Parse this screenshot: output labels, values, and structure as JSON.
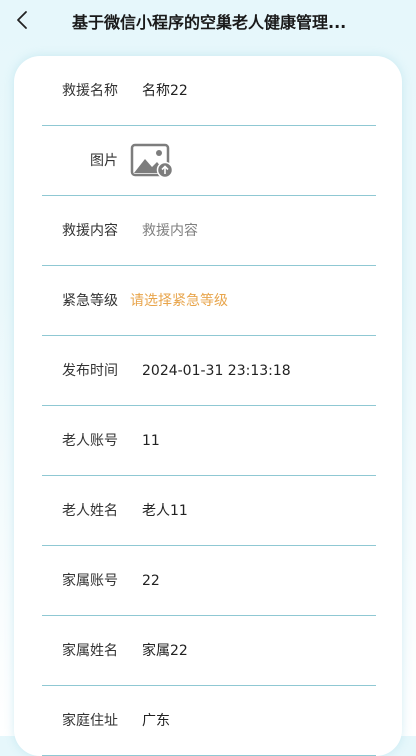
{
  "header": {
    "title": "基于微信小程序的空巢老人健康管理..."
  },
  "form": {
    "rows": [
      {
        "label": "救援名称",
        "value": "名称22",
        "kind": "text"
      },
      {
        "label": "图片",
        "value": null,
        "kind": "image",
        "icon": "image-upload-icon"
      },
      {
        "label": "救援内容",
        "value": "救援内容",
        "kind": "placeholder"
      },
      {
        "label": "紧急等级",
        "value": "请选择紧急等级",
        "kind": "select"
      },
      {
        "label": "发布时间",
        "value": "2024-01-31 23:13:18",
        "kind": "text"
      },
      {
        "label": "老人账号",
        "value": "11",
        "kind": "text"
      },
      {
        "label": "老人姓名",
        "value": "老人11",
        "kind": "text"
      },
      {
        "label": "家属账号",
        "value": "22",
        "kind": "text"
      },
      {
        "label": "家属姓名",
        "value": "家属22",
        "kind": "text"
      },
      {
        "label": "家庭住址",
        "value": "广东",
        "kind": "text"
      }
    ]
  },
  "colors": {
    "accent": "#e8a54c",
    "divider": "#8fc8d3",
    "placeholder": "#808080"
  }
}
